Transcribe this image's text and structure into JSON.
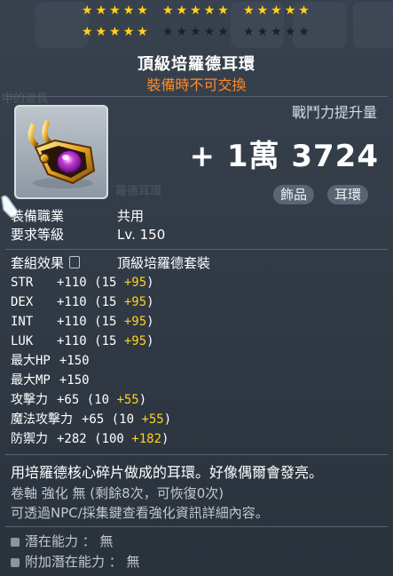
{
  "stars": {
    "row1": [
      5,
      5,
      5
    ],
    "row1_on": [
      5,
      5,
      5
    ],
    "row2": [
      5,
      5,
      5
    ],
    "row2_on": [
      5,
      0,
      0
    ],
    "glyph": "★"
  },
  "item": {
    "name": "頂級培羅德耳環",
    "trade_note": "裝備時不可交換",
    "icon": "gold-earring-icon"
  },
  "power": {
    "label": "戰鬥力提升量",
    "value": "+ 1萬 3724"
  },
  "tags": [
    "飾品",
    "耳環"
  ],
  "info": {
    "job_label": "裝備職業",
    "job_value": "共用",
    "level_label": "要求等級",
    "level_value": "Lv. 150",
    "set_label": "套組效果",
    "set_value": "頂級培羅德套裝"
  },
  "stats": [
    {
      "name": "STR",
      "base": "+110 (15 ",
      "bonus": "+95",
      "tail": ")"
    },
    {
      "name": "DEX",
      "base": "+110 (15 ",
      "bonus": "+95",
      "tail": ")"
    },
    {
      "name": "INT",
      "base": "+110 (15 ",
      "bonus": "+95",
      "tail": ")"
    },
    {
      "name": "LUK",
      "base": "+110 (15 ",
      "bonus": "+95",
      "tail": ")"
    },
    {
      "name": "最大HP",
      "base": "+150",
      "bonus": "",
      "tail": ""
    },
    {
      "name": "最大MP",
      "base": "+150",
      "bonus": "",
      "tail": ""
    },
    {
      "name": "攻擊力",
      "base": "+65 (10 ",
      "bonus": "+55",
      "tail": ")"
    },
    {
      "name": "魔法攻擊力",
      "base": "+65 (10 ",
      "bonus": "+55",
      "tail": ")"
    },
    {
      "name": "防禦力",
      "base": "+282 (100 ",
      "bonus": "+182",
      "tail": ")"
    }
  ],
  "description": "用培羅德核心碎片做成的耳環。好像偶爾會發亮。",
  "scroll": {
    "line1": "卷軸 強化 無 (剩餘8次，可恢復0次)",
    "line2": "可透過NPC/採集鍵查看強化資訊詳細內容。"
  },
  "potential": {
    "line1": "潛在能力 ： 無",
    "line2": "附加潛在能力 ： 無"
  }
}
